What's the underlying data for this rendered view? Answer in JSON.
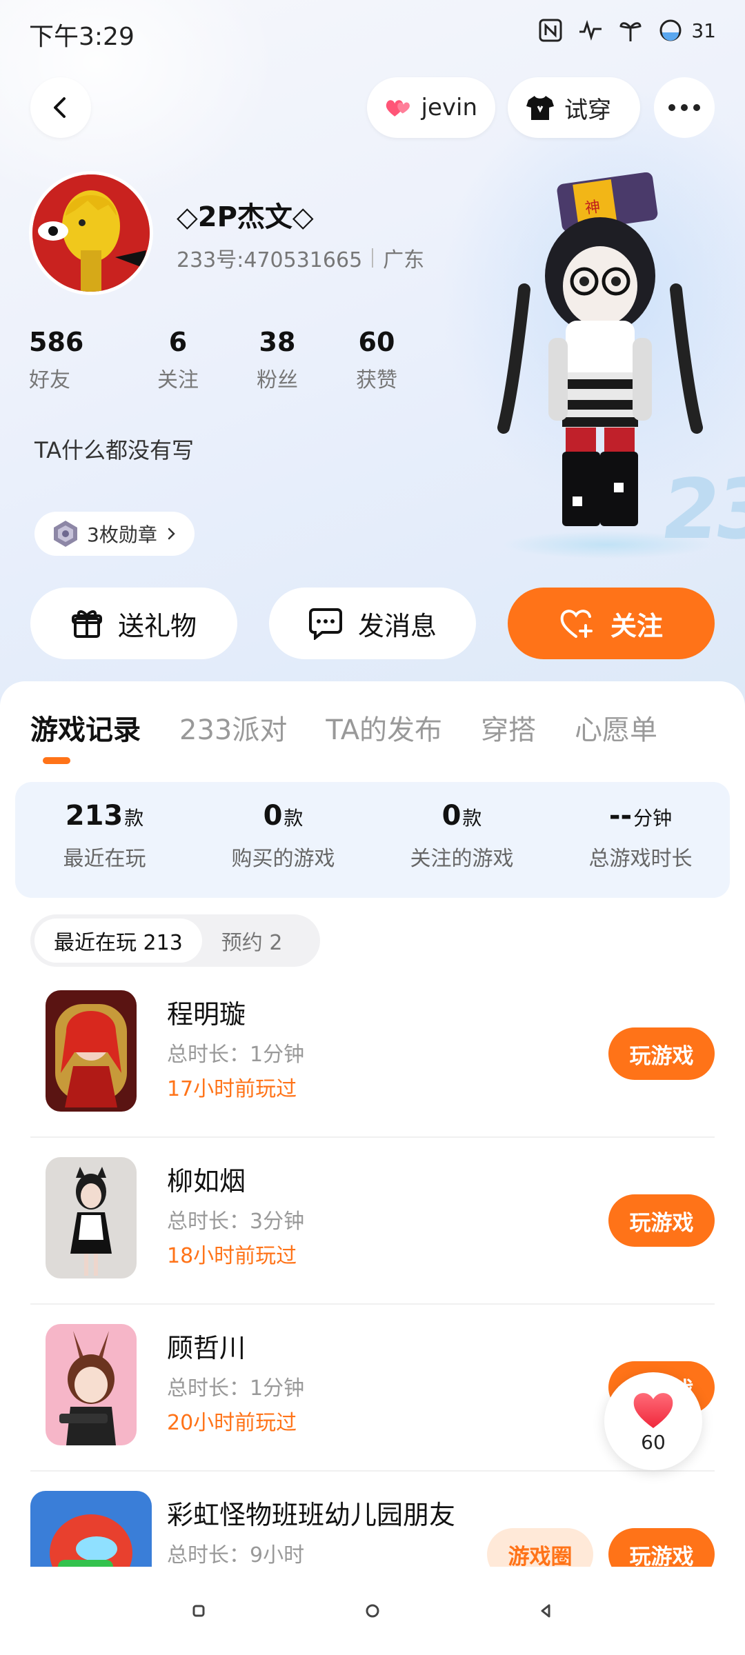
{
  "status_bar": {
    "time": "下午3:29",
    "battery": "31",
    "icons": [
      "nfc-icon",
      "activity-icon",
      "sprout-icon",
      "battery-icon"
    ]
  },
  "header": {
    "back_icon": "back-arrow-icon",
    "couple_label": "jevin",
    "try_on_label": "试穿",
    "more_icon": "more-dots-icon"
  },
  "profile": {
    "nickname": "◇2P杰文◇",
    "uid": "233号:470531665",
    "region": "广东",
    "bio": "TA什么都没有写",
    "badges_label": "3枚勋章",
    "stats": [
      {
        "num": "586",
        "label": "好友"
      },
      {
        "num": "6",
        "label": "关注"
      },
      {
        "num": "38",
        "label": "粉丝"
      },
      {
        "num": "60",
        "label": "获赞"
      }
    ]
  },
  "actions": {
    "gift": "送礼物",
    "message": "发消息",
    "follow": "关注"
  },
  "tabs": [
    "游戏记录",
    "233派对",
    "TA的发布",
    "穿搭",
    "心愿单"
  ],
  "summary": [
    {
      "num": "213",
      "unit": "款",
      "label": "最近在玩"
    },
    {
      "num": "0",
      "unit": "款",
      "label": "购买的游戏"
    },
    {
      "num": "0",
      "unit": "款",
      "label": "关注的游戏"
    },
    {
      "num": "--",
      "unit": "分钟",
      "label": "总游戏时长"
    }
  ],
  "segments": [
    {
      "label": "最近在玩 213"
    },
    {
      "label": "预约 2"
    }
  ],
  "games": [
    {
      "name": "程明璇",
      "time": "总时长：1分钟",
      "last": "17小时前玩过",
      "play": "玩游戏"
    },
    {
      "name": "柳如烟",
      "time": "总时长：3分钟",
      "last": "18小时前玩过",
      "play": "玩游戏"
    },
    {
      "name": "顾哲川",
      "time": "总时长：1分钟",
      "last": "20小时前玩过",
      "play": "玩游戏"
    },
    {
      "name": "彩虹怪物班班幼儿园朋友",
      "time": "总时长：9小时",
      "last": "",
      "play": "玩游戏",
      "circle": "游戏圈"
    }
  ],
  "like_float": {
    "count": "60"
  },
  "colors": {
    "accent": "#ff7318",
    "summary_bg": "#eef4fd"
  }
}
